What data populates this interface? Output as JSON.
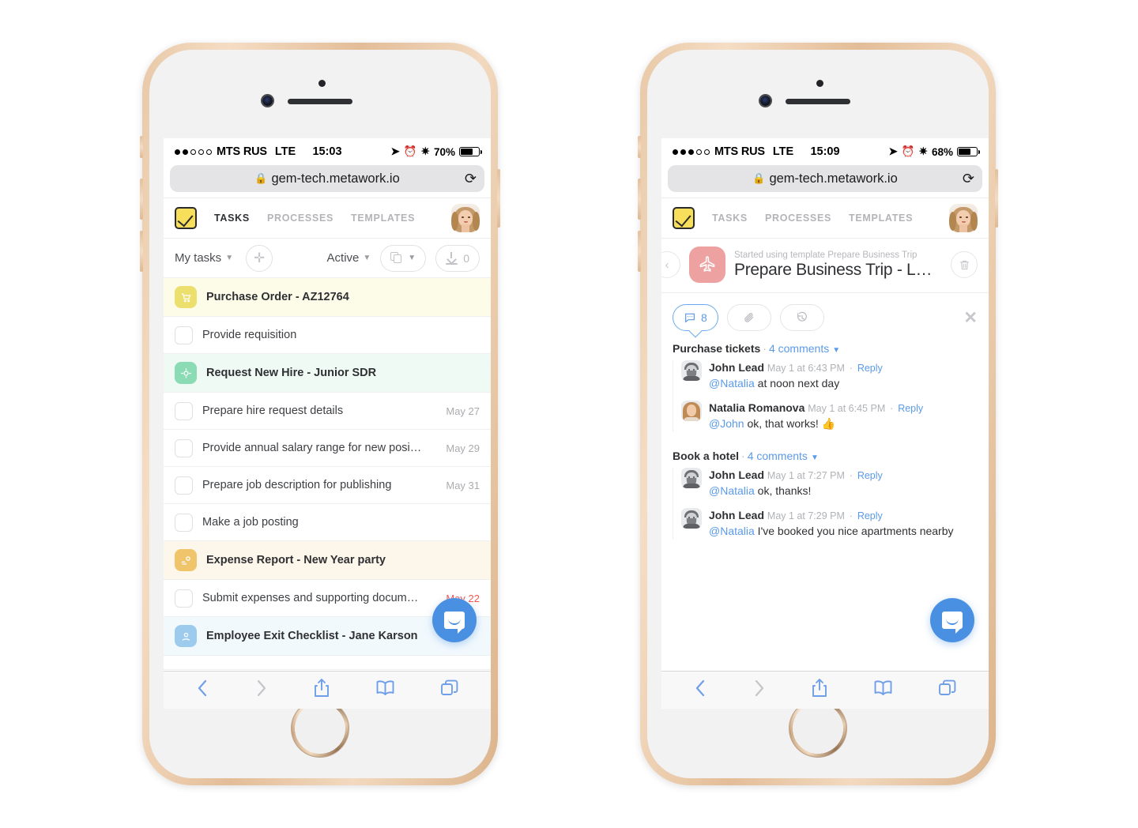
{
  "phones": [
    {
      "id": "left",
      "status_bar": {
        "signal_filled": 2,
        "signal_total": 5,
        "carrier": "MTS RUS",
        "network": "LTE",
        "time": "15:03",
        "battery_percent": "70%",
        "battery_level": 0.7,
        "icons": [
          "location-icon",
          "alarm-icon",
          "bluetooth-icon"
        ]
      },
      "browser": {
        "url": "gem-tech.metawork.io",
        "lock_icon": "lock-icon",
        "reload_icon": "reload-icon",
        "bottom_bar": [
          "back-icon",
          "forward-icon",
          "share-icon",
          "bookmarks-icon",
          "tabs-icon"
        ]
      },
      "app_nav": {
        "logo": "checkmark-logo",
        "tabs": [
          {
            "label": "TASKS",
            "active": true
          },
          {
            "label": "PROCESSES",
            "active": false
          },
          {
            "label": "TEMPLATES",
            "active": false
          }
        ],
        "avatar": "user-avatar"
      },
      "task_toolbar": {
        "scope_label": "My tasks",
        "add_icon": "plus-icon",
        "filter_label": "Active",
        "copy_icon": "copy-icon",
        "download_icon": "download-icon",
        "download_count": "0"
      },
      "task_list": [
        {
          "type": "group",
          "title": "Purchase Order - AZ12764",
          "icon": "cart-icon",
          "chip_color": "#ecdf6e",
          "row_color": "#fdfce9"
        },
        {
          "type": "task",
          "title": "Provide requisition",
          "date": "",
          "overdue": false
        },
        {
          "type": "group",
          "title": "Request New Hire - Junior SDR",
          "icon": "target-icon",
          "chip_color": "#8bdcb4",
          "row_color": "#effaf4"
        },
        {
          "type": "task",
          "title": "Prepare hire request details",
          "date": "May 27",
          "overdue": false
        },
        {
          "type": "task",
          "title": "Provide annual salary range for new posi…",
          "date": "May 29",
          "overdue": false
        },
        {
          "type": "task",
          "title": "Prepare job description for publishing",
          "date": "May 31",
          "overdue": false
        },
        {
          "type": "task",
          "title": "Make a job posting",
          "date": "",
          "overdue": false
        },
        {
          "type": "group",
          "title": "Expense Report - New Year party",
          "icon": "money-hand-icon",
          "chip_color": "#f0c46a",
          "row_color": "#fdf6ea"
        },
        {
          "type": "task",
          "title": "Submit expenses and supporting docum…",
          "date": "May 22",
          "overdue": true
        },
        {
          "type": "group",
          "title": "Employee Exit Checklist - Jane Karson",
          "icon": "person-icon",
          "chip_color": "#9ccbee",
          "row_color": "#f2f9fd"
        }
      ],
      "intercom": "intercom-chat-icon"
    },
    {
      "id": "right",
      "status_bar": {
        "signal_filled": 3,
        "signal_total": 5,
        "carrier": "MTS RUS",
        "network": "LTE",
        "time": "15:09",
        "battery_percent": "68%",
        "battery_level": 0.68,
        "icons": [
          "location-icon",
          "alarm-icon",
          "bluetooth-icon"
        ]
      },
      "browser": {
        "url": "gem-tech.metawork.io",
        "lock_icon": "lock-icon",
        "reload_icon": "reload-icon",
        "bottom_bar": [
          "back-icon",
          "forward-icon",
          "share-icon",
          "bookmarks-icon",
          "tabs-icon"
        ]
      },
      "app_nav": {
        "logo": "checkmark-logo",
        "tabs": [
          {
            "label": "TASKS",
            "active": false
          },
          {
            "label": "PROCESSES",
            "active": false
          },
          {
            "label": "TEMPLATES",
            "active": false
          }
        ],
        "avatar": "user-avatar"
      },
      "process_header": {
        "back_icon": "back-chevron-icon",
        "process_icon": "airplane-icon",
        "process_icon_color": "#eda1a1",
        "subtitle": "Started using template Prepare Business Trip",
        "title": "Prepare Business Trip - LA…",
        "delete_icon": "trash-icon"
      },
      "detail_tabs": [
        {
          "icon": "comment-icon",
          "count": "8",
          "active": true
        },
        {
          "icon": "attachment-icon",
          "count": "",
          "active": false
        },
        {
          "icon": "history-icon",
          "count": "",
          "active": false
        }
      ],
      "close_icon": "close-icon",
      "comment_groups": [
        {
          "task": "Purchase tickets",
          "separator": "·",
          "count_label": "4 comments",
          "comments": [
            {
              "avatar": "man",
              "author": "John Lead",
              "time": "May 1 at 6:43 PM",
              "reply": "Reply",
              "mention": "@Natalia",
              "text": " at noon next day"
            },
            {
              "avatar": "woman",
              "author": "Natalia Romanova",
              "time": "May 1 at 6:45 PM",
              "reply": "Reply",
              "mention": "@John",
              "text": " ok, that works! 👍"
            }
          ]
        },
        {
          "task": "Book a hotel",
          "separator": "·",
          "count_label": "4 comments",
          "comments": [
            {
              "avatar": "man",
              "author": "John Lead",
              "time": "May 1 at 7:27 PM",
              "reply": "Reply",
              "mention": "@Natalia",
              "text": " ok, thanks!"
            },
            {
              "avatar": "man",
              "author": "John Lead",
              "time": "May 1 at 7:29 PM",
              "reply": "Reply",
              "mention": "@Natalia",
              "text": " I've booked you nice apartments nearby"
            }
          ]
        }
      ],
      "intercom": "intercom-chat-icon"
    }
  ]
}
